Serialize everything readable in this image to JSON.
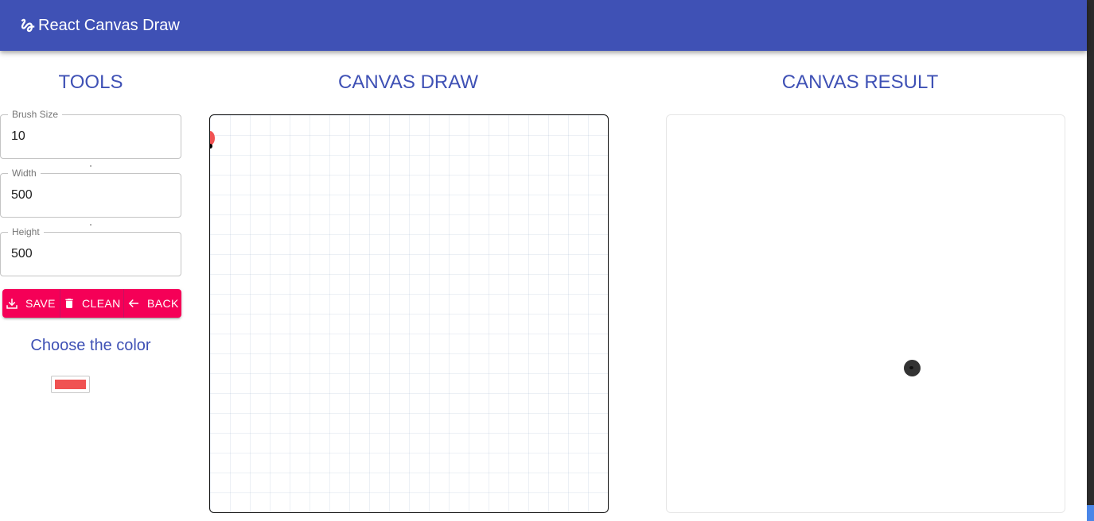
{
  "app": {
    "title": "React Canvas Draw",
    "logo_icon": "gesture-icon",
    "bar_color": "#3f51b5"
  },
  "tools": {
    "heading": "TOOLS",
    "brush_size": {
      "label": "Brush Size",
      "value": "10"
    },
    "width": {
      "label": "Width",
      "value": "500"
    },
    "height": {
      "label": "Height",
      "value": "500"
    },
    "buttons": [
      {
        "label": "SAVE",
        "icon": "download-icon"
      },
      {
        "label": "CLEAN",
        "icon": "trash-icon"
      },
      {
        "label": "BACK",
        "icon": "arrow-left-icon"
      }
    ],
    "button_color": "#f50057",
    "color_heading": "Choose the color",
    "selected_color": "#f05252"
  },
  "canvas_draw": {
    "heading": "CANVAS DRAW"
  },
  "canvas_result": {
    "heading": "CANVAS RESULT"
  }
}
